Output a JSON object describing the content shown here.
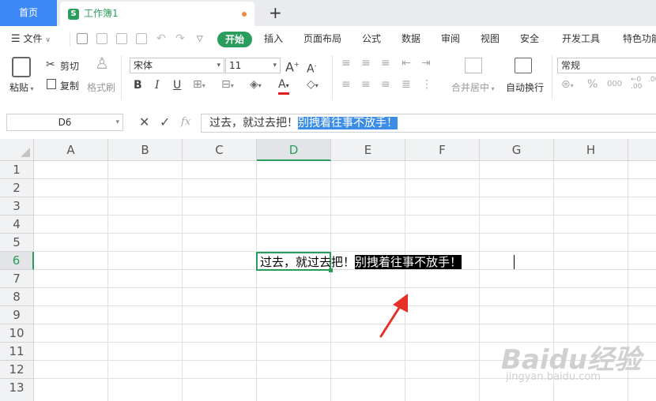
{
  "titlebar": {
    "home_tab": "首页",
    "doc_tab": "工作簿1",
    "doc_icon": "S",
    "new_tab_icon": "+"
  },
  "menubar": {
    "file": "文件",
    "items": [
      "开始",
      "插入",
      "页面布局",
      "公式",
      "数据",
      "审阅",
      "视图",
      "安全",
      "开发工具",
      "特色功能"
    ]
  },
  "ribbon": {
    "paste": "粘贴",
    "cut": "剪切",
    "copy": "复制",
    "format_painter": "格式刷",
    "font_name": "宋体",
    "font_size": "11",
    "merge_center": "合并居中",
    "wrap_text": "自动换行",
    "number_format": "常规",
    "percent": "%"
  },
  "formula_bar": {
    "cell_ref": "D6",
    "fx": "fx",
    "text_plain": "过去，就过去把！",
    "text_selected": "别拽着往事不放手！"
  },
  "grid": {
    "columns": [
      "A",
      "B",
      "C",
      "D",
      "E",
      "F",
      "G",
      "H"
    ],
    "rows": [
      "1",
      "2",
      "3",
      "4",
      "5",
      "6",
      "7",
      "8",
      "9",
      "10",
      "11",
      "12",
      "13"
    ],
    "active_column": "D",
    "active_row": "6",
    "cell_text_plain": "过去，就过去把！",
    "cell_text_selected": "别拽着往事不放手！"
  },
  "watermark": {
    "brand": "Baidu经验",
    "url": "jingyan.baidu.com"
  },
  "colors": {
    "accent_green": "#2a9d5c",
    "home_tab_blue": "#3d8af7",
    "selection_blue": "#3b8de8",
    "annotation_red": "#e8302a"
  }
}
